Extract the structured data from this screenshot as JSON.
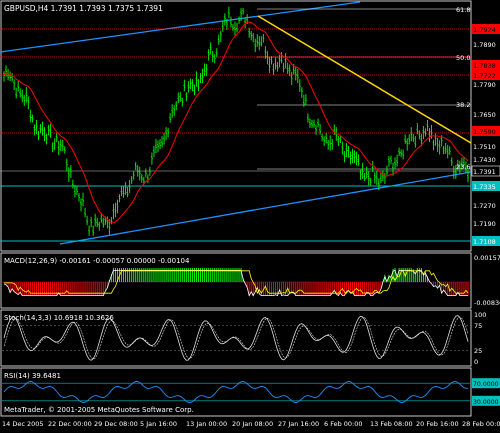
{
  "title": "GBPUSD,H4  1.7391 1.7393 1.7375 1.7391",
  "copyright": "MetaTrader, © 2001-2005 MetaQuotes Software Corp.",
  "colors": {
    "background": "#000000",
    "panel_border": "#c8c8c8",
    "text": "#ffffff",
    "bar": "#00ff00",
    "channel": "#1e90ff",
    "trendline": "#ffd700",
    "ma": "#ff0000",
    "fib": "#ffffff",
    "macd_pos": "#00ff00",
    "macd_neg": "#ff0000",
    "signal": "#ffff00",
    "horizontal_red": "#ff0000",
    "horizontal_cyan": "#00c0c0",
    "rsi_line": "#1e90ff",
    "label_red_bg": "#ff0000",
    "label_cyan_bg": "#00c0c0"
  },
  "main_panel": {
    "price_labels": [
      {
        "text": "61.8",
        "kind": "fib"
      },
      {
        "text": "1.7924",
        "kind": "red"
      },
      {
        "text": "1.7890",
        "kind": "plain"
      },
      {
        "text": "50.0",
        "kind": "fib"
      },
      {
        "text": "1.7838",
        "kind": "red"
      },
      {
        "text": "1.7790",
        "kind": "plain"
      },
      {
        "text": "1.7722",
        "kind": "red"
      },
      {
        "text": "38.2",
        "kind": "fib"
      },
      {
        "text": "1.7650",
        "kind": "plain"
      },
      {
        "text": "1.7590",
        "kind": "red"
      },
      {
        "text": "1.7510",
        "kind": "plain"
      },
      {
        "text": "1.7430",
        "kind": "plain"
      },
      {
        "text": "23.6",
        "kind": "fib"
      },
      {
        "text": "1.7391",
        "kind": "current"
      },
      {
        "text": "1.7335",
        "kind": "cyan"
      },
      {
        "text": "1.7270",
        "kind": "plain"
      },
      {
        "text": "1.7190",
        "kind": "plain"
      },
      {
        "text": "1.7108",
        "kind": "cyan"
      }
    ]
  },
  "macd_panel": {
    "label": "MACD(12,26,9) -0.00161 -0.00057 0.00000 -0.00104",
    "scale": [
      "0.00157",
      "-0.00836"
    ]
  },
  "stoch_panel": {
    "label": "Stoch(14,3,3) 10.6918 10.3626",
    "scale": [
      "100",
      "75",
      "25",
      "0"
    ]
  },
  "rsi_panel": {
    "label": "RSI(14) 39.6481",
    "scale": [
      "70.0000",
      "30.0000"
    ]
  },
  "time_axis": [
    "14 Dec 2005",
    "22 Dec 00:00",
    "29 Dec 08:00",
    "5 Jan 16:00",
    "13 Jan 00:00",
    "20 Jan 08:00",
    "27 Jan 16:00",
    "6 Feb 00:00",
    "13 Feb 08:00",
    "20 Feb 16:00",
    "28 Feb 00:00"
  ],
  "chart_data": {
    "type": "line",
    "title": "GBPUSD,H4  1.7391 1.7393 1.7375 1.7391",
    "x": [
      "14 Dec 2005",
      "22 Dec 00:00",
      "29 Dec 08:00",
      "5 Jan 16:00",
      "13 Jan 00:00",
      "20 Jan 08:00",
      "27 Jan 16:00",
      "6 Feb 00:00",
      "13 Feb 08:00",
      "20 Feb 16:00",
      "28 Feb 00:00"
    ],
    "series": [
      {
        "values": [
          1.774,
          1.751,
          1.718,
          1.738,
          1.769,
          1.795,
          1.778,
          1.75,
          1.735,
          1.753,
          1.7391
        ]
      }
    ],
    "ylim": [
      1.71,
      1.8
    ],
    "grid": false
  }
}
